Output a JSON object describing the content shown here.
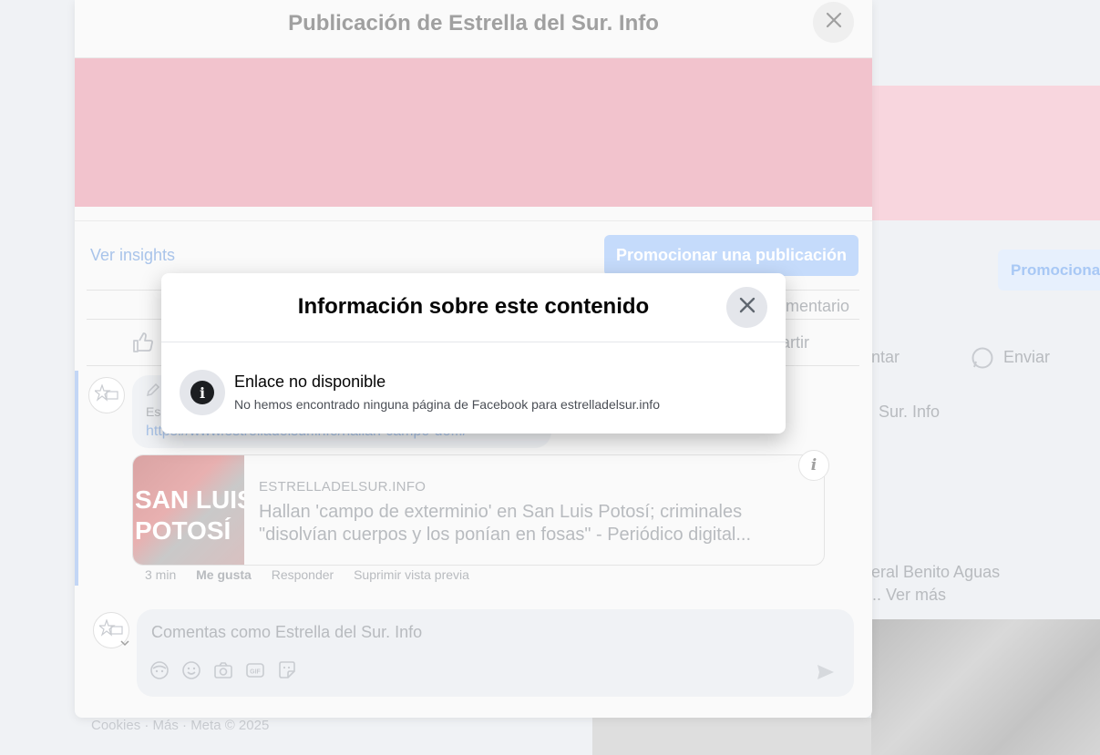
{
  "background_page": {
    "promote_label": "Promocionar",
    "action_comment": "ntar",
    "action_send": "Enviar",
    "page_name": "Sur. Info",
    "author_text": "eral Benito Aguas",
    "see_more": "... Ver más",
    "footer": "Cookies · Más · Meta © 2025"
  },
  "post_dialog": {
    "title": "Publicación de Estrella del Sur. Info",
    "view_insights": "Ver insights",
    "promote_button": "Promocionar una publicación",
    "comment_count_link": "omentario",
    "share_action": "artir",
    "comment": {
      "author_partial": "Es",
      "url": "https://www.estrelladelsur.info/hallan-campo-de.../",
      "link_preview": {
        "thumbnail_text_line1": "SAN LUIS",
        "thumbnail_text_line2": "POTOSÍ",
        "domain": "ESTRELLADELSUR.INFO",
        "title": "Hallan 'campo de exterminio' en San Luis Potosí; criminales \"disolvían cuerpos y los ponían en fosas\" - Periódico digital..."
      },
      "meta": {
        "time": "3 min",
        "like": "Me gusta",
        "reply": "Responder",
        "remove_preview": "Suprimir vista previa"
      }
    },
    "composer": {
      "placeholder": "Comentas como Estrella del Sur. Info"
    }
  },
  "modal": {
    "title": "Información sobre este contenido",
    "heading": "Enlace no disponible",
    "description": "No hemos encontrado ninguna página de Facebook para estrelladelsur.info"
  },
  "icons": {
    "close": "close-icon",
    "info": "info-icon",
    "like": "thumbs-up-icon",
    "send": "send-icon",
    "whatsapp": "whatsapp-icon"
  }
}
